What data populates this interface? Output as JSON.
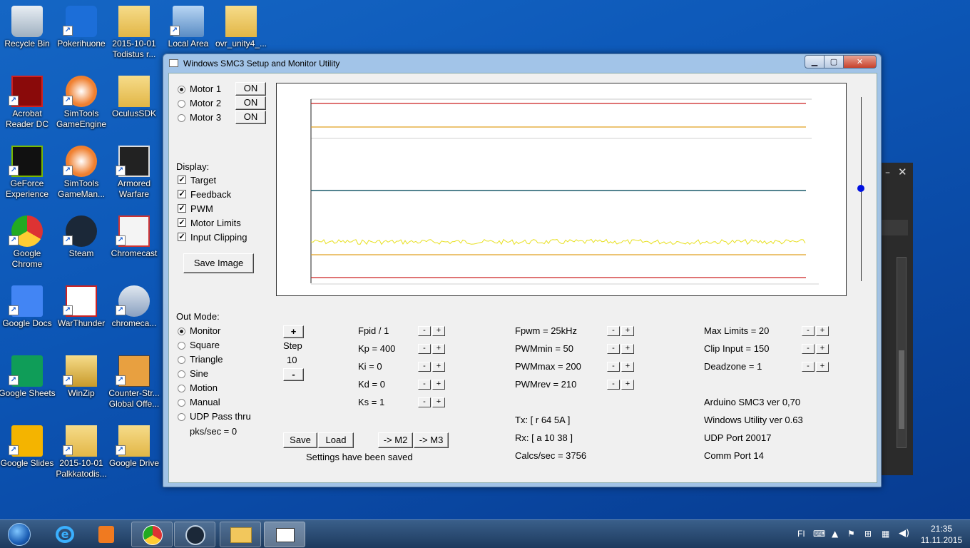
{
  "desktop": {
    "icons": [
      {
        "label": "Recycle Bin"
      },
      {
        "label": "Pokerihuone"
      },
      {
        "label": "2015-10-01 Todistus r..."
      },
      {
        "label": "Local Area"
      },
      {
        "label": "ovr_unity4_..."
      },
      {
        "label": "Acrobat Reader DC"
      },
      {
        "label": "SimTools GameEngine"
      },
      {
        "label": "OculusSDK"
      },
      {
        "label": "GeForce Experience"
      },
      {
        "label": "SimTools GameMan..."
      },
      {
        "label": "Armored Warfare"
      },
      {
        "label": "Google Chrome"
      },
      {
        "label": "Steam"
      },
      {
        "label": "Chromecast"
      },
      {
        "label": "Google Docs"
      },
      {
        "label": "WarThunder"
      },
      {
        "label": "chromeca..."
      },
      {
        "label": "Google Sheets"
      },
      {
        "label": "WinZip"
      },
      {
        "label": "Counter-Str... Global Offe..."
      },
      {
        "label": "Google Slides"
      },
      {
        "label": "2015-10-01 Palkkatodis..."
      },
      {
        "label": "Google Drive"
      }
    ]
  },
  "window": {
    "title": "Windows SMC3 Setup and Monitor Utility"
  },
  "motors": [
    {
      "label": "Motor 1",
      "state": "ON"
    },
    {
      "label": "Motor 2",
      "state": "ON"
    },
    {
      "label": "Motor 3",
      "state": "ON"
    }
  ],
  "display": {
    "heading": "Display:",
    "items": [
      {
        "label": "Target"
      },
      {
        "label": "Feedback"
      },
      {
        "label": "PWM"
      },
      {
        "label": "Motor Limits"
      },
      {
        "label": "Input Clipping"
      }
    ],
    "save_image": "Save Image"
  },
  "out_mode": {
    "heading": "Out Mode:",
    "modes": [
      {
        "label": "Monitor"
      },
      {
        "label": "Square"
      },
      {
        "label": "Triangle"
      },
      {
        "label": "Sine"
      },
      {
        "label": "Motion"
      },
      {
        "label": "Manual"
      },
      {
        "label": "UDP Pass thru"
      }
    ],
    "pks": "pks/sec = 0"
  },
  "step": {
    "plus": "+",
    "label": "Step",
    "value": "10",
    "minus": "-"
  },
  "pid": [
    {
      "label": "Fpid / 1"
    },
    {
      "label": "Kp = 400"
    },
    {
      "label": "Ki = 0"
    },
    {
      "label": "Kd = 0"
    },
    {
      "label": "Ks = 1"
    }
  ],
  "pwm": [
    {
      "label": "Fpwm = 25kHz"
    },
    {
      "label": "PWMmin = 50"
    },
    {
      "label": "PWMmax = 200"
    },
    {
      "label": "PWMrev = 210"
    }
  ],
  "limits": [
    {
      "label": "Max Limits = 20"
    },
    {
      "label": "Clip Input = 150"
    },
    {
      "label": "Deadzone = 1"
    }
  ],
  "buttons": {
    "save": "Save",
    "load": "Load",
    "to_m2": "-> M2",
    "to_m3": "-> M3",
    "minus": "-",
    "plus": "+"
  },
  "status": {
    "settings": "Settings have been saved",
    "tx": "Tx: [ r 64 5A ]",
    "rx": "Rx: [ a 10 38 ]",
    "calcs": "Calcs/sec = 3756",
    "arduino": "Arduino SMC3 ver 0,70",
    "utility": "Windows Utility ver 0.63",
    "udp": "UDP Port 20017",
    "comm": "Comm Port 14"
  },
  "taskbar": {
    "lang": "FI",
    "time": "21:35",
    "date": "11.11.2015"
  },
  "colors": {
    "limit_line": "#cc2020",
    "clip_line": "#e0a020",
    "target_line": "#1a5a6a",
    "feedback_line": "#e8e020",
    "slider_knob": "#0010e0"
  }
}
